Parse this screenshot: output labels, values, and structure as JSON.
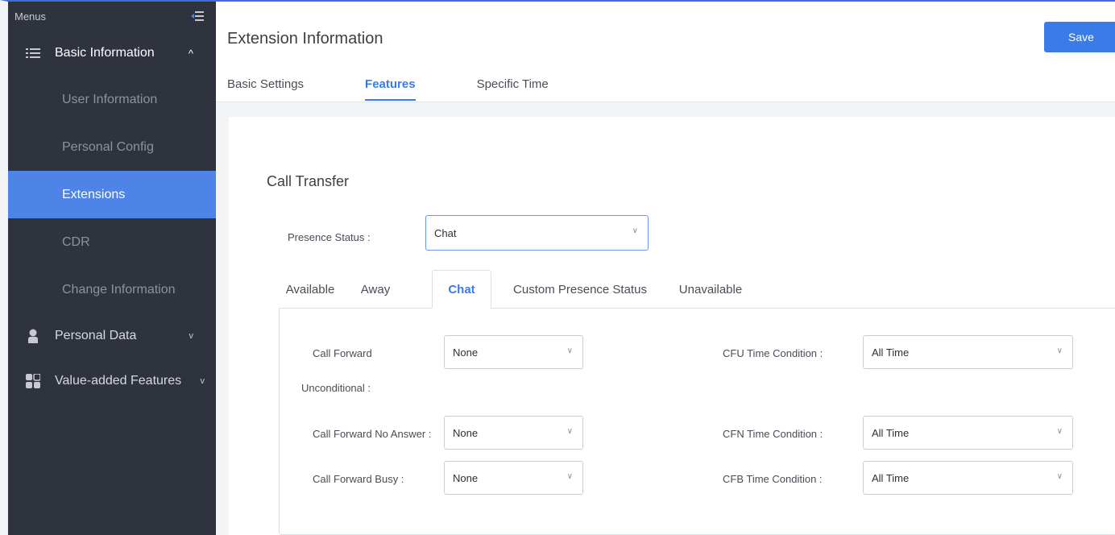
{
  "sidebar": {
    "menus_label": "Menus",
    "groups": [
      {
        "label": "Basic Information",
        "chevron": "^",
        "icon": "list-icon"
      },
      {
        "label": "Personal Data",
        "chevron": "v",
        "icon": "person-icon"
      },
      {
        "label": "Value-added Features",
        "chevron": "v",
        "icon": "grid-icon"
      }
    ],
    "items": [
      {
        "label": "User Information"
      },
      {
        "label": "Personal Config"
      },
      {
        "label": "Extensions"
      },
      {
        "label": "CDR"
      },
      {
        "label": "Change Information"
      }
    ]
  },
  "header": {
    "title": "Extension Information",
    "save_label": "Save",
    "tabs": [
      {
        "label": "Basic Settings"
      },
      {
        "label": "Features"
      },
      {
        "label": "Specific Time"
      }
    ]
  },
  "call_transfer": {
    "section_title": "Call Transfer",
    "presence_label": "Presence Status :",
    "presence_value": "Chat",
    "presence_tabs": [
      {
        "label": "Available"
      },
      {
        "label": "Away"
      },
      {
        "label": "Chat"
      },
      {
        "label": "Custom Presence Status"
      },
      {
        "label": "Unavailable"
      }
    ],
    "fields": {
      "cfu_label_line1": "Call Forward",
      "cfu_label_line2": "Unconditional :",
      "cfu_value": "None",
      "cfn_label": "Call Forward No Answer :",
      "cfn_value": "None",
      "cfb_label": "Call Forward Busy :",
      "cfb_value": "None",
      "cfu_time_label": "CFU Time Condition :",
      "cfu_time_value": "All Time",
      "cfn_time_label": "CFN Time Condition :",
      "cfn_time_value": "All Time",
      "cfb_time_label": "CFB Time Condition :",
      "cfb_time_value": "All Time"
    }
  },
  "colors": {
    "sidebar_bg": "#2f333e",
    "accent": "#4e84e8",
    "save_button": "#3a7bea"
  }
}
